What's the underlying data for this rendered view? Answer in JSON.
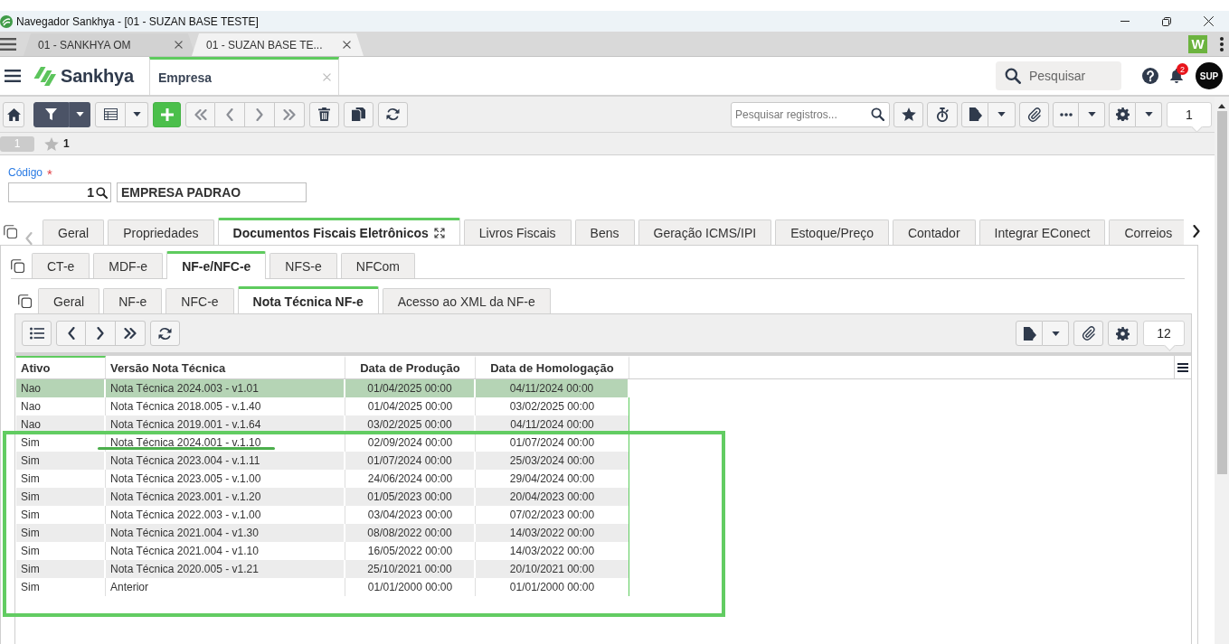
{
  "window": {
    "title": "Navegador Sankhya - [01 - SUZAN BASE TESTE]"
  },
  "browser_tabs": [
    {
      "label": "01 - SANKHYA OM",
      "selected": false
    },
    {
      "label": "01 - SUZAN BASE TE...",
      "selected": true
    }
  ],
  "extension": {
    "label": "W"
  },
  "app_header": {
    "brand": "Sankhya",
    "screen_tab": {
      "label": "Empresa",
      "selected": true
    },
    "search": {
      "placeholder": "Pesquisar"
    },
    "notifications": {
      "count": "2"
    },
    "avatar": {
      "label": "SUP"
    }
  },
  "toolbar": {
    "navigation_disabled": true,
    "search": {
      "placeholder": "Pesquisar registros..."
    },
    "record_count": "1"
  },
  "record_bar": {
    "page": "1",
    "favorites": "1"
  },
  "form": {
    "code": {
      "label": "Código",
      "required_mark": "*",
      "value": "1"
    },
    "description": {
      "value": "EMPRESA PADRAO"
    }
  },
  "main_tabs": [
    {
      "label": "Geral",
      "selected": false
    },
    {
      "label": "Propriedades",
      "selected": false
    },
    {
      "label": "Documentos Fiscais Eletrônicos",
      "selected": true
    },
    {
      "label": "Livros Fiscais",
      "selected": false
    },
    {
      "label": "Bens",
      "selected": false
    },
    {
      "label": "Geração ICMS/IPI",
      "selected": false
    },
    {
      "label": "Estoque/Preço",
      "selected": false
    },
    {
      "label": "Contador",
      "selected": false
    },
    {
      "label": "Integrar EConect",
      "selected": false
    },
    {
      "label": "Correios",
      "selected": false
    }
  ],
  "document_tabs": [
    {
      "label": "CT-e",
      "selected": false
    },
    {
      "label": "MDF-e",
      "selected": false
    },
    {
      "label": "NF-e/NFC-e",
      "selected": true
    },
    {
      "label": "NFS-e",
      "selected": false
    },
    {
      "label": "NFCom",
      "selected": false
    }
  ],
  "nfe_tabs": [
    {
      "label": "Geral",
      "selected": false
    },
    {
      "label": "NF-e",
      "selected": false
    },
    {
      "label": "NFC-e",
      "selected": false
    },
    {
      "label": "Nota Técnica NF-e",
      "selected": true
    },
    {
      "label": "Acesso ao XML da NF-e",
      "selected": false
    }
  ],
  "grid": {
    "record_count": "12",
    "columns": [
      {
        "label": "Ativo",
        "kind": "text",
        "active": true
      },
      {
        "label": "Versão Nota Técnica",
        "kind": "text",
        "active": false
      },
      {
        "label": "Data de Produção",
        "kind": "date",
        "active": false
      },
      {
        "label": "Data de Homologação",
        "kind": "date",
        "active": false
      }
    ],
    "rows": [
      {
        "cells": [
          "Nao",
          "Nota Técnica 2024.003 - v1.01",
          "01/04/2025 00:00",
          "04/11/2024 00:00"
        ],
        "selected": true,
        "underlined": false
      },
      {
        "cells": [
          "Nao",
          "Nota Técnica 2018.005 - v.1.40",
          "01/04/2025 00:00",
          "03/02/2025 00:00"
        ],
        "selected": false,
        "underlined": false
      },
      {
        "cells": [
          "Nao",
          "Nota Técnica 2019.001 - v.1.64",
          "03/02/2025 00:00",
          "04/11/2024 00:00"
        ],
        "selected": false,
        "underlined": false
      },
      {
        "cells": [
          "Sim",
          "Nota Técnica 2024.001 - v.1.10",
          "02/09/2024 00:00",
          "01/07/2024 00:00"
        ],
        "selected": false,
        "underlined": true
      },
      {
        "cells": [
          "Sim",
          "Nota Técnica 2023.004 - v.1.11",
          "01/07/2024 00:00",
          "25/03/2024 00:00"
        ],
        "selected": false,
        "underlined": false
      },
      {
        "cells": [
          "Sim",
          "Nota Técnica 2023.005 - v.1.00",
          "24/06/2024 00:00",
          "29/04/2024 00:00"
        ],
        "selected": false,
        "underlined": false
      },
      {
        "cells": [
          "Sim",
          "Nota Técnica 2023.001 - v.1.20",
          "01/05/2023 00:00",
          "20/04/2023 00:00"
        ],
        "selected": false,
        "underlined": false
      },
      {
        "cells": [
          "Sim",
          "Nota Técnica 2022.003 - v.1.00",
          "03/04/2023 00:00",
          "07/02/2023 00:00"
        ],
        "selected": false,
        "underlined": false
      },
      {
        "cells": [
          "Sim",
          "Nota Técnica 2021.004 - v1.30",
          "08/08/2022 00:00",
          "14/03/2022 00:00"
        ],
        "selected": false,
        "underlined": false
      },
      {
        "cells": [
          "Sim",
          "Nota Técnica 2021.004 - v1.10",
          "16/05/2022 00:00",
          "14/03/2022 00:00"
        ],
        "selected": false,
        "underlined": false
      },
      {
        "cells": [
          "Sim",
          "Nota Técnica 2020.005 - v1.21",
          "25/10/2021 00:00",
          "20/10/2021 00:00"
        ],
        "selected": false,
        "underlined": false
      },
      {
        "cells": [
          "Sim",
          "Anterior",
          "01/01/2000 00:00",
          "01/01/2000 00:00"
        ],
        "selected": false,
        "underlined": false
      }
    ]
  },
  "annotations": [
    {
      "kind": "box"
    }
  ]
}
